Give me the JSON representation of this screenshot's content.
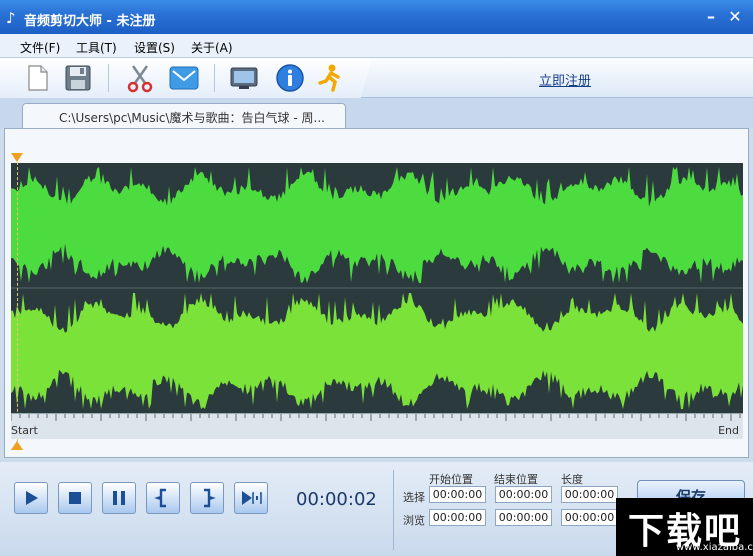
{
  "window": {
    "icon": "music-note-icon",
    "title": "音频剪切大师 - 未注册",
    "minimize": "–",
    "close": "✕"
  },
  "menu": {
    "items": [
      "文件(F)",
      "工具(T)",
      "设置(S)",
      "关于(A)"
    ]
  },
  "toolbar": {
    "buttons": [
      {
        "name": "new-file-icon"
      },
      {
        "name": "save-disk-icon"
      },
      {
        "name": "scissors-icon"
      },
      {
        "name": "email-icon"
      },
      {
        "name": "monitor-icon"
      },
      {
        "name": "info-icon"
      },
      {
        "name": "running-man-icon"
      }
    ],
    "register_label": "立即注册"
  },
  "tab": {
    "label": "C:\\Users\\pc\\Music\\魔术与歌曲：告白气球 - 周..."
  },
  "waveform": {
    "start_label": "Start",
    "end_label": "End",
    "colors": {
      "background": "#2b3a3c",
      "top_channel": "#4ddc3f",
      "bottom_channel": "#7be23a"
    }
  },
  "controls": {
    "buttons": [
      "play-icon",
      "stop-icon",
      "pause-icon",
      "set-start-icon",
      "set-end-icon",
      "play-selection-icon"
    ],
    "time": "00:00:02",
    "col_start": "开始位置",
    "col_end": "结束位置",
    "col_length": "长度",
    "row_select": "选择",
    "row_browse": "浏览",
    "select": {
      "start": "00:00:00",
      "end": "00:00:00",
      "length": "00:00:00"
    },
    "browse": {
      "start": "00:00:00",
      "end": "00:00:00",
      "length": "00:00:00"
    },
    "save_label": "保存"
  },
  "watermark": {
    "text": "下载吧",
    "url": "www.xiazaiba.com"
  }
}
